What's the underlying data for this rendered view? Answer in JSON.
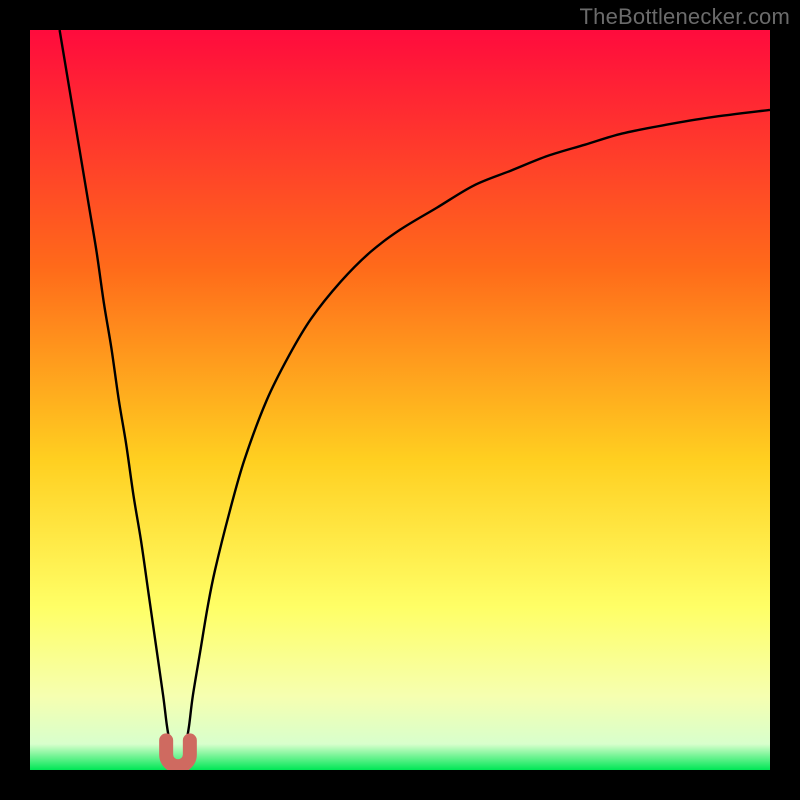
{
  "watermark": "TheBottlenecker.com",
  "colors": {
    "frame": "#000000",
    "grad_top": "#ff0b3d",
    "grad_mid1": "#ff6a1a",
    "grad_mid2": "#ffcf20",
    "grad_low": "#ffff66",
    "grad_low2": "#f6ffb0",
    "grad_green": "#00e756",
    "curve": "#000000",
    "marker": "#cf6a60"
  },
  "chart_data": {
    "type": "line",
    "title": "",
    "xlabel": "",
    "ylabel": "",
    "xlim": [
      0,
      100
    ],
    "ylim": [
      0,
      100
    ],
    "series": [
      {
        "name": "left-arm",
        "x": [
          4,
          5,
          6,
          7,
          8,
          9,
          10,
          11,
          12,
          13,
          14,
          15,
          16,
          17,
          18,
          18.5,
          19
        ],
        "y": [
          100,
          94,
          88,
          82,
          76,
          70,
          63,
          57,
          50,
          44,
          37,
          31,
          24,
          17,
          10,
          6,
          3
        ]
      },
      {
        "name": "right-arm",
        "x": [
          21,
          21.5,
          22,
          23,
          24,
          25,
          27,
          29,
          32,
          35,
          38,
          42,
          46,
          50,
          55,
          60,
          65,
          70,
          75,
          80,
          86,
          92,
          100
        ],
        "y": [
          3,
          6,
          10,
          16,
          22,
          27,
          35,
          42,
          50,
          56,
          61,
          66,
          70,
          73,
          76,
          79,
          81,
          83,
          84.5,
          86,
          87.2,
          88.2,
          89.2
        ]
      }
    ],
    "marker": {
      "name": "minimum-U",
      "x_center": 20,
      "width": 3.2,
      "y_top": 4.0,
      "y_bottom": 0.5
    },
    "gradient_stops": [
      {
        "pos": 0.0,
        "color": "#ff0b3d"
      },
      {
        "pos": 0.32,
        "color": "#ff6a1a"
      },
      {
        "pos": 0.58,
        "color": "#ffcf20"
      },
      {
        "pos": 0.78,
        "color": "#ffff66"
      },
      {
        "pos": 0.9,
        "color": "#f6ffb0"
      },
      {
        "pos": 0.965,
        "color": "#d8ffcc"
      },
      {
        "pos": 1.0,
        "color": "#00e756"
      }
    ]
  }
}
